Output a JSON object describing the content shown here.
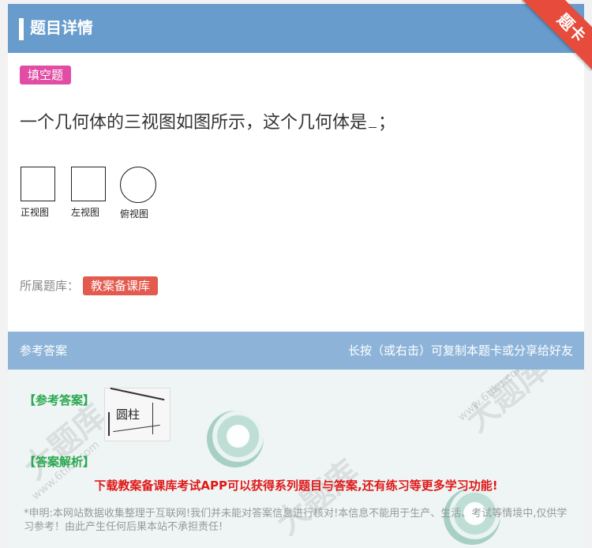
{
  "header": {
    "title": "题目详情"
  },
  "ribbon": {
    "label": "题卡"
  },
  "question": {
    "type_badge": "填空题",
    "text_before": "一个几何体的三视图如图所示，这个几何体是",
    "text_after": "；",
    "views": [
      {
        "label": "正视图",
        "shape": "square"
      },
      {
        "label": "左视图",
        "shape": "square"
      },
      {
        "label": "俯视图",
        "shape": "circle"
      }
    ]
  },
  "bank": {
    "label": "所属题库：",
    "name": "教案备课库"
  },
  "answer": {
    "header_title": "参考答案",
    "share_hint": "长按（或右击）可复制本题卡或分享给好友",
    "ref_label": "【参考答案】",
    "ref_image_text": "圆柱",
    "analysis_label": "【答案解析】",
    "promo": "下载教案备课库考试APP可以获得系列题目与答案,还有练习等更多学习功能!",
    "disclaimer": "*申明:本网站数据收集整理于互联网!我们并未能对答案信息进行核对!本信息不能用于生产、生活、考试等情境中,仅供学习参考！由此产生任何后果本站不承担责任!"
  },
  "watermark": {
    "brand": "大题库",
    "site": "www.6tiku.com"
  },
  "colors": {
    "header_bg": "#679ccd",
    "type_badge": "#e14da4",
    "bank_badge": "#e35a4e",
    "answer_header_bg": "#8db4d8",
    "label_green": "#29a84f",
    "promo_red": "#e01818"
  }
}
